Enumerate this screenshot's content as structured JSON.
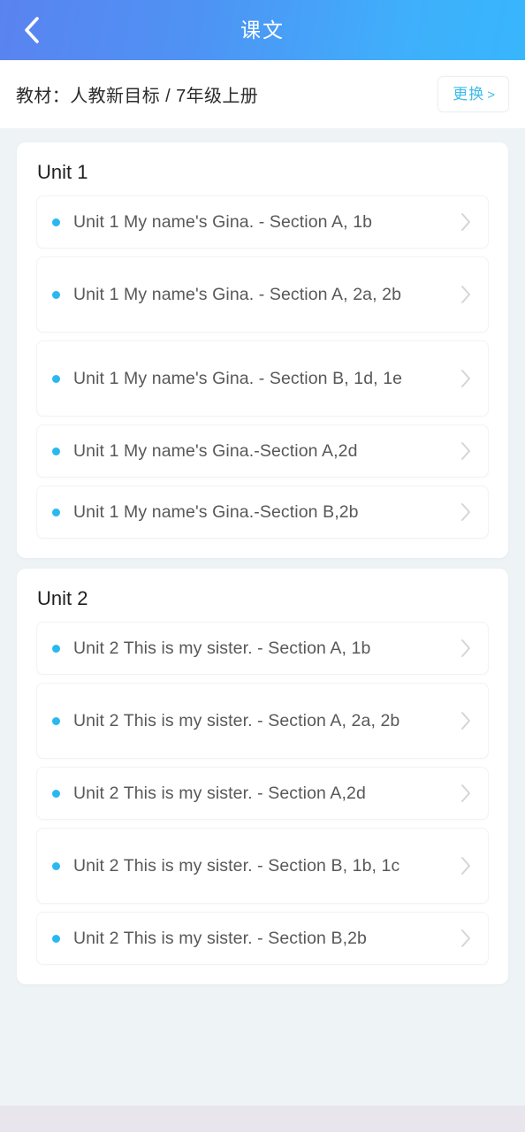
{
  "header": {
    "title": "课文",
    "back_icon": "chevron-left-icon"
  },
  "textbook_bar": {
    "label": "教材：人教新目标 / 7年级上册",
    "change_button": "更换",
    "change_chevron": ">"
  },
  "colors": {
    "header_gradient_start": "#5a83f0",
    "header_gradient_end": "#37b6fc",
    "accent_cyan": "#2ab8ef",
    "link_cyan": "#3bbcea",
    "page_background": "#eef3f6",
    "card_background": "#ffffff",
    "text_primary": "#1f1f1f",
    "text_secondary": "#585858",
    "chevron_gray": "#d2d6da",
    "bottom_bar": "#e8e6ec"
  },
  "units": [
    {
      "title": "Unit 1",
      "lessons": [
        {
          "text": "Unit 1 My name's Gina. - Section A, 1b",
          "two_line": false
        },
        {
          "text": "Unit 1 My name's Gina. - Section A, 2a, 2b",
          "two_line": true
        },
        {
          "text": "Unit 1 My name's Gina. - Section B, 1d, 1e",
          "two_line": true
        },
        {
          "text": "Unit 1 My name's Gina.-Section A,2d",
          "two_line": false
        },
        {
          "text": "Unit 1 My name's Gina.-Section B,2b",
          "two_line": false
        }
      ]
    },
    {
      "title": "Unit 2",
      "lessons": [
        {
          "text": "Unit 2 This is my sister. - Section A, 1b",
          "two_line": false
        },
        {
          "text": "Unit 2 This is my sister. - Section A, 2a, 2b",
          "two_line": true
        },
        {
          "text": "Unit 2 This is my sister. - Section A,2d",
          "two_line": false
        },
        {
          "text": "Unit 2 This is my sister. - Section B, 1b, 1c",
          "two_line": true
        },
        {
          "text": "Unit 2 This is my sister. - Section B,2b",
          "two_line": false
        }
      ]
    }
  ]
}
